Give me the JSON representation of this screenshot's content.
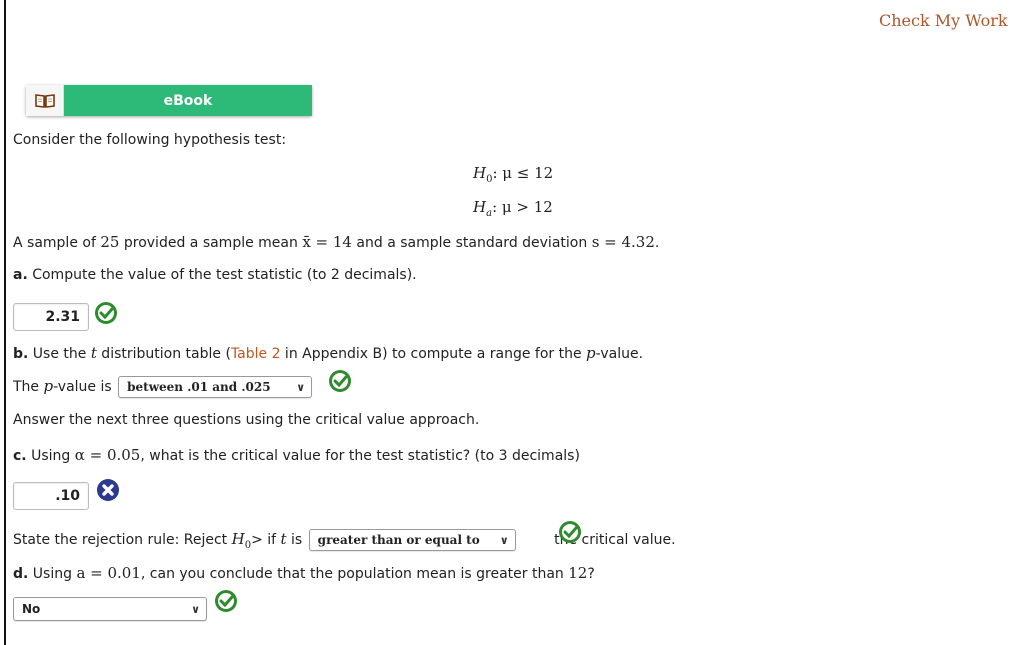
{
  "header": {
    "check_my_work": "Check My Work"
  },
  "ebook": {
    "label": "eBook",
    "icon": "book-icon"
  },
  "intro": "Consider the following hypothesis test:",
  "hypotheses": {
    "null": {
      "symbol": "H",
      "sub": "0",
      "relation": ": μ ≤ 12"
    },
    "alt": {
      "symbol": "H",
      "sub": "a",
      "relation": ": μ > 12"
    }
  },
  "sample": {
    "p1": "A sample of ",
    "n": "25",
    "p2": " provided a sample mean ",
    "xbar": "x̄ = 14",
    "p3": " and a sample standard deviation ",
    "s": "s = 4.32",
    "p4": "."
  },
  "part_a": {
    "letter": "a.",
    "text": " Compute the value of the test statistic (to 2 decimals).",
    "answer": "2.31",
    "status": "correct"
  },
  "part_b": {
    "letter": "b.",
    "p1": " Use the ",
    "t": "t",
    "p2": " distribution table (",
    "link": "Table 2",
    "p3": " in Appendix B) to compute a range for the ",
    "p": "p",
    "p4": "-value.",
    "answer_prefix_1": "The ",
    "answer_p": "p",
    "answer_prefix_2": "-value is",
    "selected": "between .01 and .025",
    "status": "correct"
  },
  "critical_intro": "Answer the next three questions using the critical value approach.",
  "part_c": {
    "letter": "c.",
    "p1": " Using ",
    "alpha": "α = 0.05",
    "p2": ", what is the critical value for the test statistic? (to 3 decimals)",
    "answer": ".10",
    "status": "incorrect"
  },
  "rejection": {
    "p1": "State the rejection rule: Reject ",
    "h": "H",
    "hsub": "0",
    "p2": "> if ",
    "t": "t",
    "p3": " is",
    "selected": "greater than or equal to",
    "p4": "the critical value.",
    "status": "correct"
  },
  "part_d": {
    "letter": "d.",
    "p1": " Using ",
    "alpha": "a = 0.01",
    "p2": ", can you conclude that the population mean is greater than ",
    "value": "12",
    "p3": "?",
    "selected": "No",
    "status": "correct"
  },
  "colors": {
    "accent": "#2dba78",
    "link": "#c0581f",
    "correct": "#2e8b2e",
    "incorrect": "#2b3a8c"
  }
}
